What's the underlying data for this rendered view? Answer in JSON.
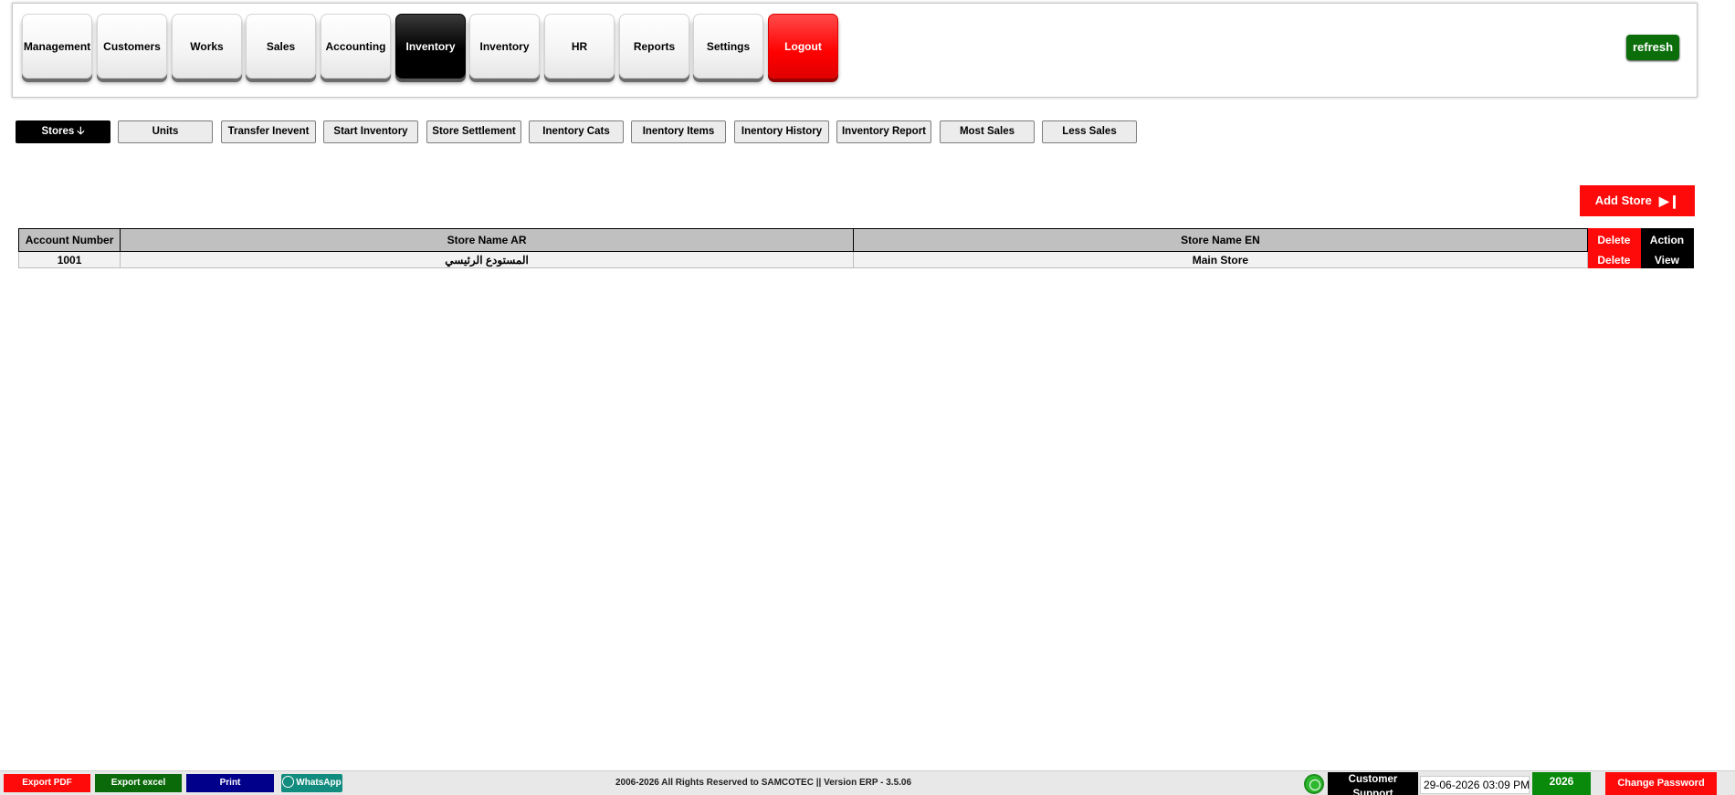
{
  "nav": {
    "items": [
      {
        "label": "Management"
      },
      {
        "label": "Customers"
      },
      {
        "label": "Works"
      },
      {
        "label": "Sales"
      },
      {
        "label": "Accounting"
      },
      {
        "label": "Inventory"
      },
      {
        "label": "Inventory"
      },
      {
        "label": "HR"
      },
      {
        "label": "Reports"
      },
      {
        "label": "Settings"
      },
      {
        "label": "Logout"
      }
    ],
    "refresh_label": "refresh"
  },
  "subtabs": {
    "items": [
      {
        "label": "Stores"
      },
      {
        "label": "Units"
      },
      {
        "label": "Transfer Inevent"
      },
      {
        "label": "Start Inventory"
      },
      {
        "label": "Store Settlement"
      },
      {
        "label": "Inentory Cats"
      },
      {
        "label": "Inentory Items"
      },
      {
        "label": "Inentory History"
      },
      {
        "label": "Inventory Report"
      },
      {
        "label": "Most Sales"
      },
      {
        "label": "Less Sales"
      }
    ]
  },
  "add_store_label": "Add Store",
  "table": {
    "headers": {
      "account_number": "Account Number",
      "store_name_ar": "Store Name AR",
      "store_name_en": "Store Name EN",
      "delete": "Delete",
      "action": "Action"
    },
    "rows": [
      {
        "account_number": "1001",
        "store_name_ar": "المستودع الرئيسي",
        "store_name_en": "Main Store",
        "delete": "Delete",
        "action": "View"
      }
    ]
  },
  "footer": {
    "export_pdf": "Export PDF",
    "export_excel": "Export excel",
    "print": "Print",
    "whatsapp": "WhatsApp",
    "copyright": "2006-2026 All Rights Reserved to SAMCOTEC || Version ERP - 3.5.06",
    "support_line1": "Customer",
    "support_line2": "Support",
    "datetime": "29-06-2026 03:09 PM",
    "year": "2026",
    "change_password": "Change Password"
  },
  "colors": {
    "active": "#000000",
    "danger": "#ff0a0a",
    "success": "#0a6a0a",
    "print": "#00008b",
    "whatsapp": "#128c7e"
  }
}
